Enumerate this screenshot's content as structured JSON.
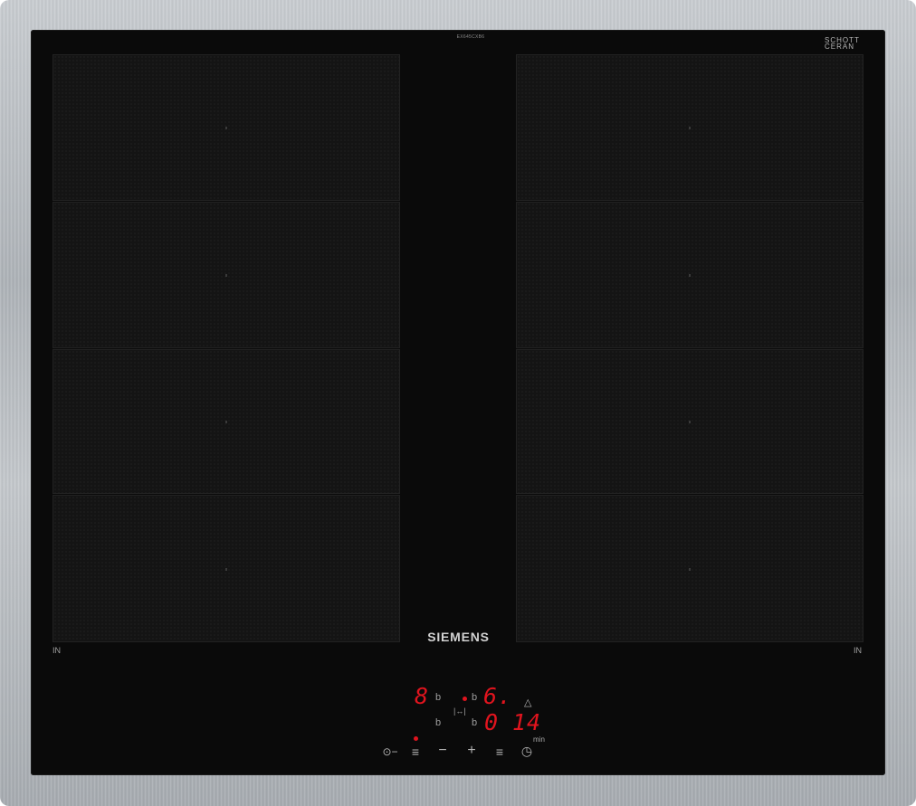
{
  "model_code": "EX645CXB6",
  "ceran_logo": "SCHOTT CERAN",
  "brand": "SIEMENS",
  "zone_labels": {
    "left": "IN",
    "right": "IN"
  },
  "zones": {
    "left": [
      "flex-zone-left-1",
      "flex-zone-left-2",
      "flex-zone-left-3",
      "flex-zone-left-4"
    ],
    "right": [
      "flex-zone-right-1",
      "flex-zone-right-2",
      "flex-zone-right-3",
      "flex-zone-right-4"
    ]
  },
  "control_panel": {
    "zone1_power": "8",
    "zone1_flag": "b",
    "zone2_flag_left": "b",
    "zone2_power": "6.",
    "zone3_flag": "b",
    "zone4_flag": "b",
    "timer_digit": "0",
    "timer_value": "14",
    "timer_unit": "min",
    "flex_bridge_symbol": "|↔|",
    "buttons": {
      "lock": "⊙−",
      "zone_select": "≡",
      "minus": "−",
      "plus": "+",
      "zone_select_right": "≡",
      "timer": "◷",
      "bell": "△"
    }
  },
  "colors": {
    "display_red": "#e0141e",
    "glass": "#0a0a0a",
    "frame": "#b5babf"
  }
}
